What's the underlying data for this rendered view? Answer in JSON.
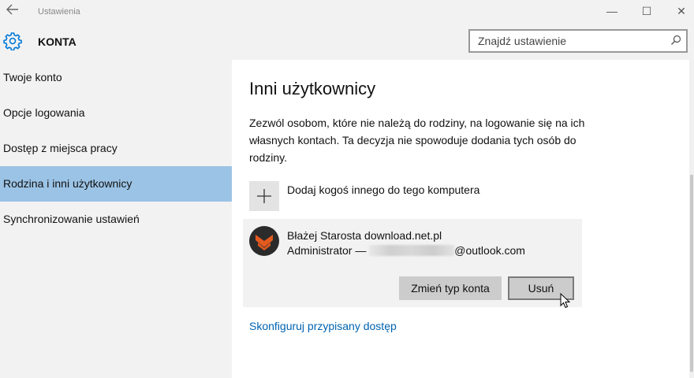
{
  "window": {
    "title": "Ustawienia",
    "back_icon": "arrow-left-icon",
    "minimize_glyph": "—",
    "maximize_glyph": "☐",
    "close_glyph": "✕"
  },
  "header": {
    "app_name": "KONTA",
    "icon": "gear-icon",
    "search_placeholder": "Znajdź ustawienie",
    "accent": "#0078d7"
  },
  "sidebar": {
    "items": [
      {
        "label": "Twoje konto"
      },
      {
        "label": "Opcje logowania"
      },
      {
        "label": "Dostęp z miejsca pracy"
      },
      {
        "label": "Rodzina i inni użytkownicy",
        "selected": true
      },
      {
        "label": "Synchronizowanie ustawień"
      }
    ],
    "selected_color": "#9bc3e5"
  },
  "main": {
    "heading": "Inni użytkownicy",
    "description": "Zezwól osobom, które nie należą do rodziny, na logowanie się na ich własnych kontach. Ta decyzja nie spowoduje dodania tych osób do rodziny.",
    "add_user_label": "Dodaj kogoś innego do tego komputera",
    "user": {
      "name": "Błażej Starosta download.net.pl",
      "role_prefix": "Administrator —",
      "email_suffix": "@outlook.com",
      "change_type_label": "Zmień typ konta",
      "remove_label": "Usuń"
    },
    "assigned_access_link": "Skonfiguruj przypisany dostęp",
    "link_color": "#0063b1"
  }
}
